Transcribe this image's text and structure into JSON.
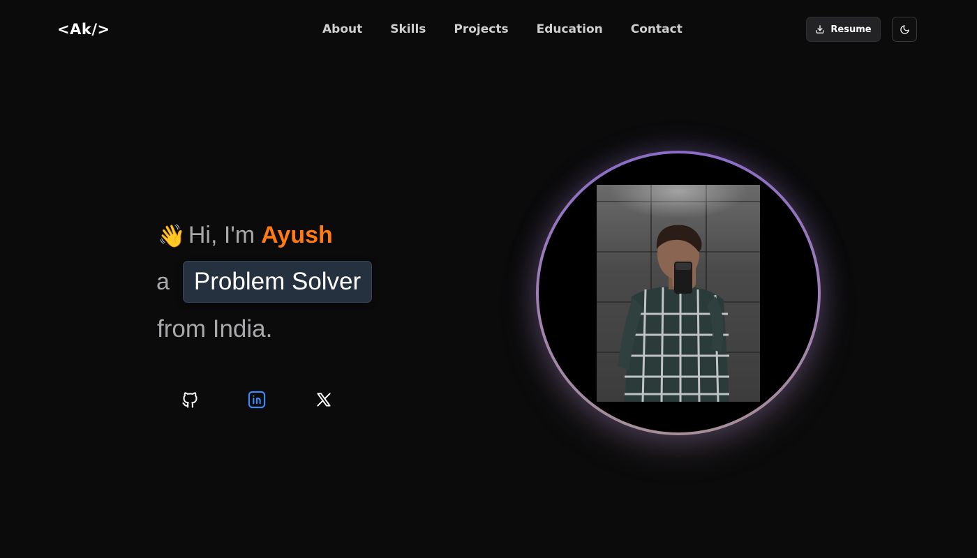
{
  "header": {
    "logo": "<Ak/>",
    "nav": [
      {
        "label": "About"
      },
      {
        "label": "Skills"
      },
      {
        "label": "Projects"
      },
      {
        "label": "Education"
      },
      {
        "label": "Contact"
      }
    ],
    "resume_label": "Resume",
    "download_icon": "download-icon",
    "theme_icon": "moon-icon"
  },
  "hero": {
    "wave_emoji": "👋",
    "greeting": "Hi, I'm",
    "name": "Ayush",
    "prefix": "a",
    "role": "Problem Solver",
    "location": "from India."
  },
  "socials": [
    {
      "icon": "github-icon"
    },
    {
      "icon": "linkedin-icon"
    },
    {
      "icon": "x-icon"
    }
  ],
  "colors": {
    "background": "#0b0b0c",
    "accent": "#ff7a12",
    "badge_bg": "#263140",
    "ring_top": "#8a6cc6",
    "ring_bottom": "#a58f96",
    "linkedin": "#3d8bff"
  }
}
